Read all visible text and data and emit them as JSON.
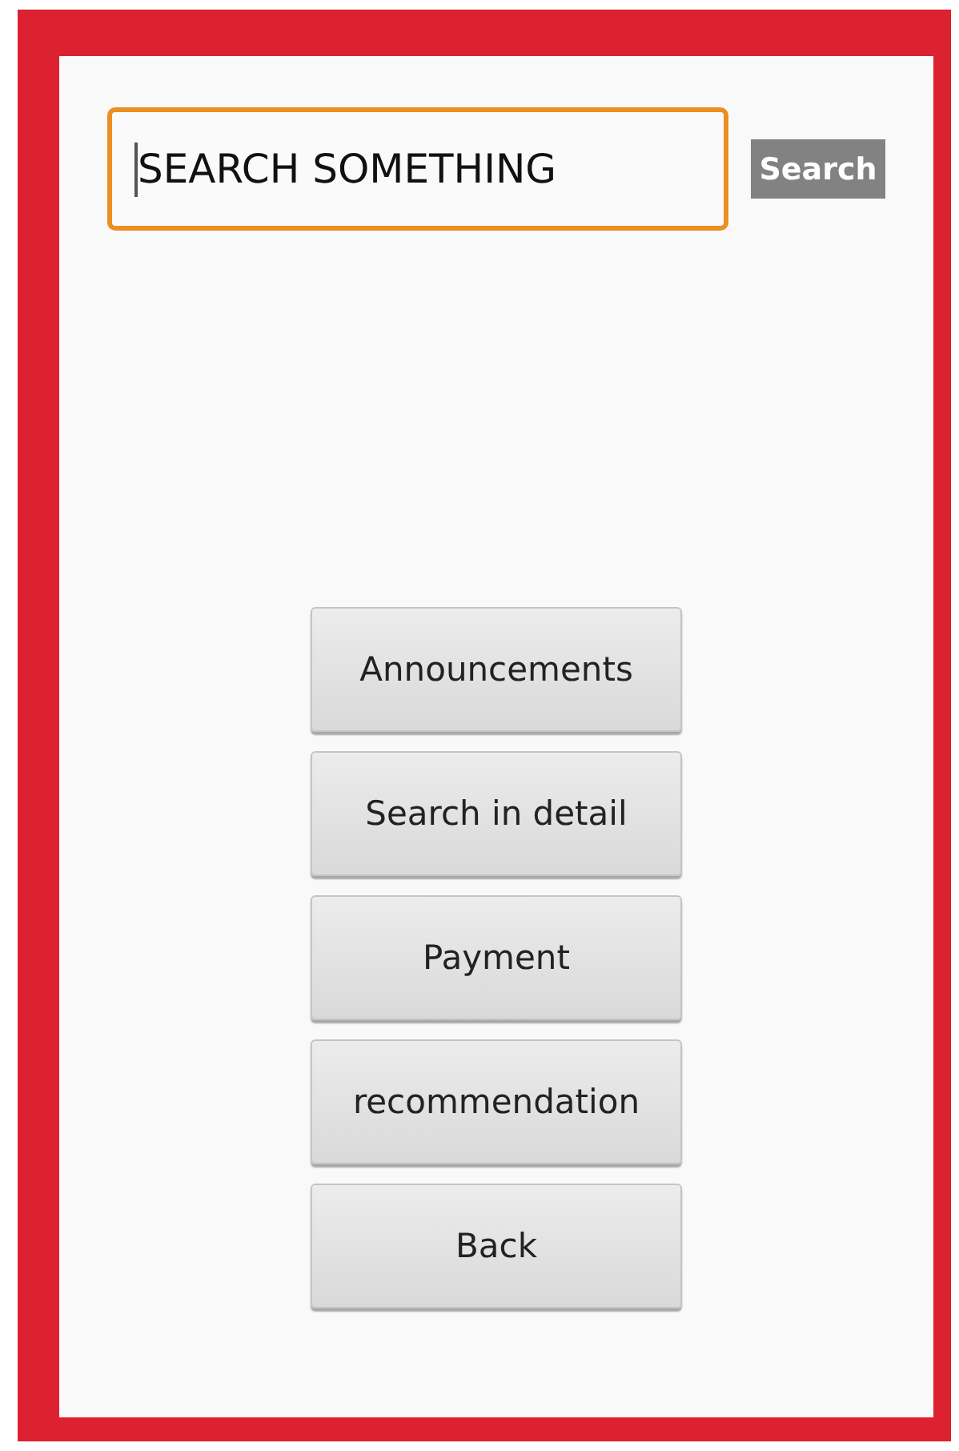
{
  "search_field": {
    "value": "SEARCH SOMETHING",
    "focused": true
  },
  "search_button": {
    "label": "Search"
  },
  "menu_buttons": [
    {
      "label": "Announcements"
    },
    {
      "label": "Search in detail"
    },
    {
      "label": "Payment"
    },
    {
      "label": "recommendation"
    },
    {
      "label": "Back"
    }
  ]
}
